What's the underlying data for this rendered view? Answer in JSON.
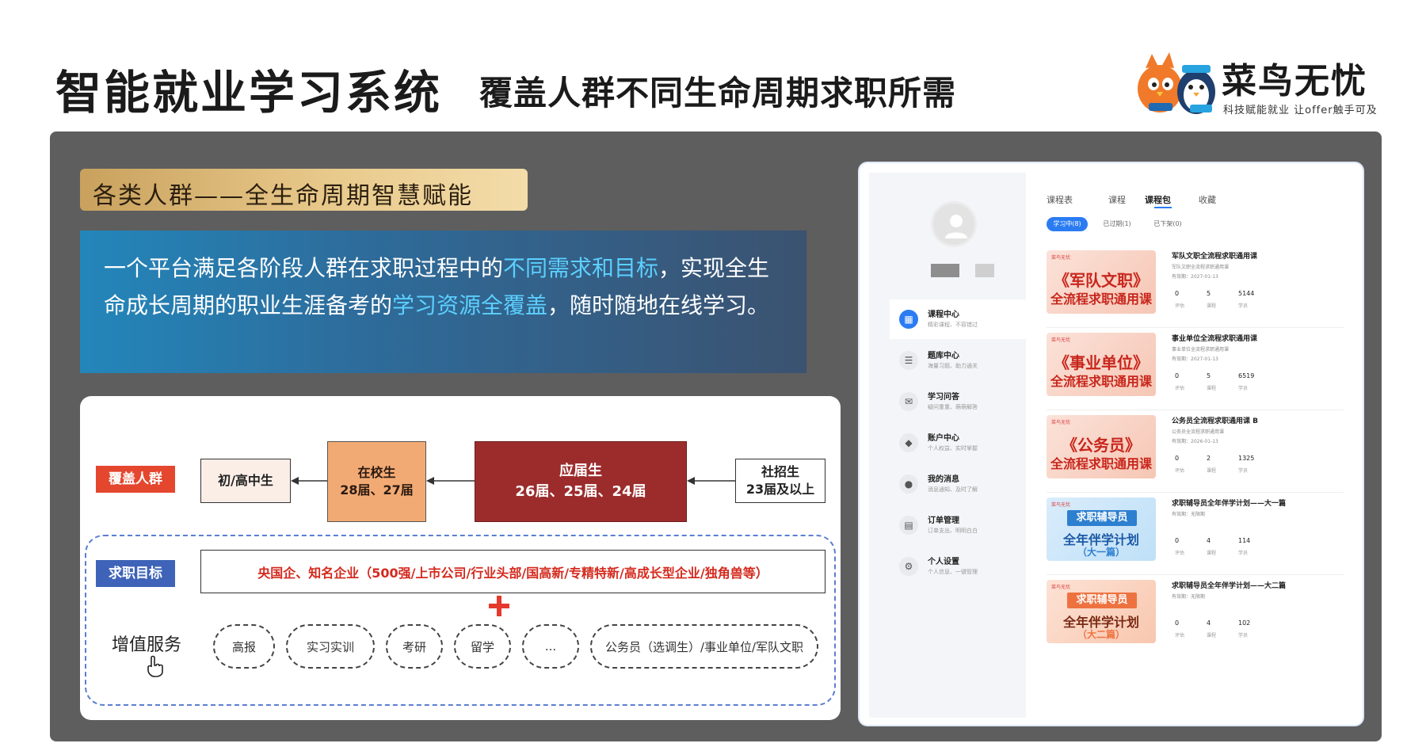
{
  "header": {
    "title": "智能就业学习系统",
    "subtitle": "覆盖人群不同生命周期求职所需",
    "logo_name": "菜鸟无忧",
    "logo_tagline": "科技赋能就业 让offer触手可及"
  },
  "band": {
    "text": "各类人群——全生命周期智慧赋能"
  },
  "description": {
    "part1": "一个平台满足各阶段人群在求职过程中的",
    "highlight1": "不同需求和目标",
    "part2": "，实现全生命成长周期的职业生涯备考的",
    "highlight2": "学习资源全覆盖",
    "part3": "，随时随地在线学习。"
  },
  "coverage": {
    "tag": "覆盖人群",
    "box_chu": "初/高中生",
    "box_zaixiao_1": "在校生",
    "box_zaixiao_2": "28届、27届",
    "box_yingjie_1": "应届生",
    "box_yingjie_2": "26届、25届、24届",
    "box_shezhao_1": "社招生",
    "box_shezhao_2": "23届及以上"
  },
  "goals": {
    "tag": "求职目标",
    "text": "央国企、知名企业（500强/上市公司/行业头部/国高新/专精特新/高成长型企业/独角兽等）"
  },
  "services": {
    "label": "增值服务",
    "items": [
      "高报",
      "实习实训",
      "考研",
      "留学",
      "...",
      "公务员（选调生）/事业单位/军队文职"
    ]
  },
  "app": {
    "nav": [
      {
        "title": "课程中心",
        "sub": "精彩课程、不容错过"
      },
      {
        "title": "题库中心",
        "sub": "海量习题、助力通关"
      },
      {
        "title": "学习问答",
        "sub": "疑问重重、萌萌解答"
      },
      {
        "title": "账户中心",
        "sub": "个人权益、实时掌握"
      },
      {
        "title": "我的消息",
        "sub": "消息通知、及时了解"
      },
      {
        "title": "订单管理",
        "sub": "订单支出、明明白白"
      },
      {
        "title": "个人设置",
        "sub": "个人信息、一键管理"
      }
    ],
    "tabs": [
      "课程表",
      "课程",
      "课程包",
      "收藏"
    ],
    "chips": [
      "学习中(8)",
      "已过期(1)",
      "已下架(0)"
    ],
    "stat_labels": [
      "评估",
      "课程",
      "学员"
    ],
    "courses": [
      {
        "title": "军队文职全流程求职通用课",
        "sub": "军队文职全流程求职通用课",
        "date": "有效期：2027-01-13",
        "thumb_brand": "菜鸟无忧",
        "thumb_1": "《军队文职》",
        "thumb_2": "全流程求职通用课",
        "stats": [
          "0",
          "5",
          "5144"
        ]
      },
      {
        "title": "事业单位全流程求职通用课",
        "sub": "事业单位全流程求职通用课",
        "date": "有效期：2027-01-13",
        "thumb_brand": "菜鸟无忧",
        "thumb_1": "《事业单位》",
        "thumb_2": "全流程求职通用课",
        "stats": [
          "0",
          "5",
          "6519"
        ]
      },
      {
        "title": "公务员全流程求职通用课 B",
        "sub": "公务员全流程求职通用课",
        "date": "有效期：2026-01-13",
        "thumb_brand": "菜鸟无忧",
        "thumb_1": "《公务员》",
        "thumb_2": "全流程求职通用课",
        "stats": [
          "0",
          "2",
          "1325"
        ]
      },
      {
        "title": "求职辅导员全年伴学计划——大一篇",
        "sub": "有效期：无限期",
        "date": "",
        "thumb_brand": "菜鸟无忧",
        "thumb_1": "求职辅导员",
        "thumb_2": "全年伴学计划",
        "thumb_3": "（大一篇）",
        "stats": [
          "0",
          "4",
          "114"
        ]
      },
      {
        "title": "求职辅导员全年伴学计划——大二篇",
        "sub": "有效期：无限期",
        "date": "",
        "thumb_brand": "菜鸟无忧",
        "thumb_1": "求职辅导员",
        "thumb_2": "全年伴学计划",
        "thumb_3": "（大二篇）",
        "stats": [
          "0",
          "4",
          "102"
        ]
      }
    ]
  },
  "colors": {
    "accent_blue": "#2b7cf3",
    "tag_red": "#e4462e",
    "tag_blue": "#3e63b8",
    "yingjie_red": "#9c2c2c",
    "zaixiao_orange": "#f2aa74",
    "highlight_cyan": "#5cd0ff"
  }
}
